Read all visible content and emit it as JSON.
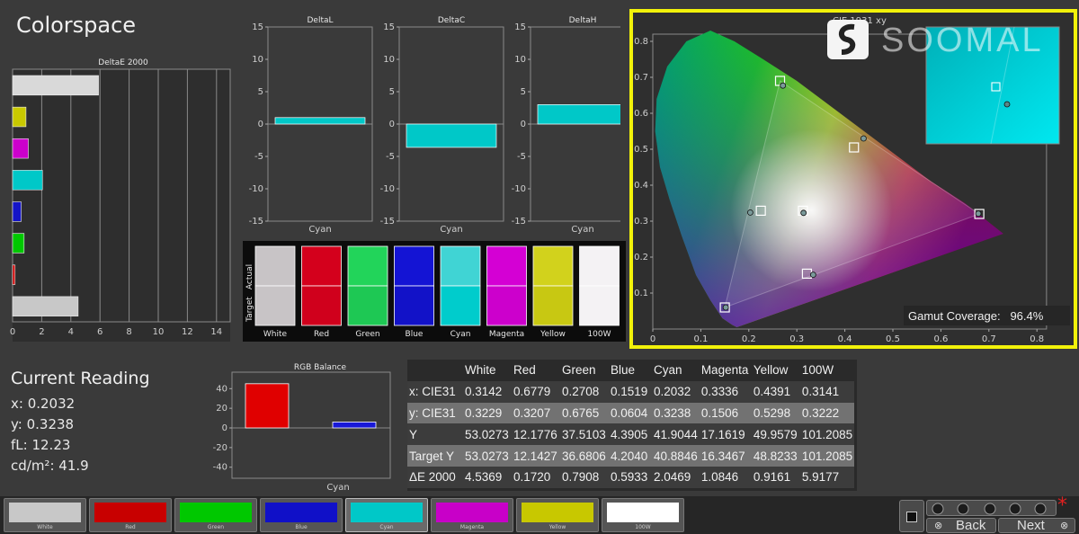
{
  "title": "Colorspace",
  "deltae": {
    "label": "DeltaE 2000",
    "xticks": [
      "0",
      "2",
      "4",
      "6",
      "8",
      "10",
      "12",
      "14"
    ],
    "bars": [
      {
        "name": "White",
        "value": 5.9,
        "color": "#d9d9d9"
      },
      {
        "name": "Yellow",
        "value": 0.92,
        "color": "#c9c900"
      },
      {
        "name": "Magenta",
        "value": 1.08,
        "color": "#cc00cc"
      },
      {
        "name": "Cyan",
        "value": 2.05,
        "color": "#00c8c8"
      },
      {
        "name": "Blue",
        "value": 0.59,
        "color": "#1414c8"
      },
      {
        "name": "Green",
        "value": 0.79,
        "color": "#00c800"
      },
      {
        "name": "Red",
        "value": 0.17,
        "color": "#c80000"
      },
      {
        "name": "100W",
        "value": 4.5,
        "color": "#c8c8c8"
      }
    ]
  },
  "delta_panels": [
    {
      "label": "DeltaL",
      "value": 1.0,
      "cat": "Cyan"
    },
    {
      "label": "DeltaC",
      "value": -3.6,
      "cat": "Cyan"
    },
    {
      "label": "DeltaH",
      "value": 3.0,
      "cat": "Cyan"
    }
  ],
  "delta_ticks": [
    "15",
    "10",
    "5",
    "0",
    "-5",
    "-10",
    "-15"
  ],
  "swatches": {
    "actual_label": "Actual",
    "target_label": "Target",
    "items": [
      {
        "label": "White",
        "actual": "#c8c4c6",
        "target": "#c8c4c6"
      },
      {
        "label": "Red",
        "actual": "#d4001c",
        "target": "#d0001c"
      },
      {
        "label": "Green",
        "actual": "#22d45a",
        "target": "#1ec854"
      },
      {
        "label": "Blue",
        "actual": "#1414d4",
        "target": "#1212c8"
      },
      {
        "label": "Cyan",
        "actual": "#40d4d4",
        "target": "#00cccc"
      },
      {
        "label": "Magenta",
        "actual": "#d400d4",
        "target": "#cc00cc"
      },
      {
        "label": "Yellow",
        "actual": "#d2d21c",
        "target": "#c8c812"
      },
      {
        "label": "100W",
        "actual": "#f4f2f4",
        "target": "#f4f2f4"
      }
    ]
  },
  "cie": {
    "label": "CIE 1931 xy",
    "xticks": [
      "0",
      "0.1",
      "0.2",
      "0.3",
      "0.4",
      "0.5",
      "0.6",
      "0.7",
      "0.8"
    ],
    "yticks": [
      "0.1",
      "0.2",
      "0.3",
      "0.4",
      "0.5",
      "0.6",
      "0.7",
      "0.8"
    ],
    "gamut_label": "Gamut Coverage:",
    "gamut_value": "96.4%",
    "targets": [
      [
        0.68,
        0.32
      ],
      [
        0.265,
        0.69
      ],
      [
        0.15,
        0.06
      ],
      [
        0.225,
        0.329
      ],
      [
        0.321,
        0.154
      ],
      [
        0.419,
        0.505
      ],
      [
        0.3127,
        0.329
      ]
    ],
    "measured": [
      [
        0.678,
        0.321
      ],
      [
        0.271,
        0.677
      ],
      [
        0.152,
        0.06
      ],
      [
        0.203,
        0.324
      ],
      [
        0.334,
        0.151
      ],
      [
        0.439,
        0.53
      ],
      [
        0.314,
        0.323
      ]
    ],
    "watermark": "SOOMAL"
  },
  "reading": {
    "title": "Current Reading",
    "lines": [
      "x: 0.2032",
      "y: 0.3238",
      "fL: 12.23",
      "cd/m²: 41.9"
    ]
  },
  "rgb_balance": {
    "label": "RGB Balance",
    "cat": "Cyan",
    "yticks": [
      "40",
      "20",
      "0",
      "-20",
      "-40"
    ],
    "red": 45,
    "blue": 6
  },
  "table": {
    "headers": [
      "",
      "White",
      "Red",
      "Green",
      "Blue",
      "Cyan",
      "Magenta",
      "Yellow",
      "100W"
    ],
    "rows": [
      [
        "x: CIE31",
        "0.3142",
        "0.6779",
        "0.2708",
        "0.1519",
        "0.2032",
        "0.3336",
        "0.4391",
        "0.3141"
      ],
      [
        "y: CIE31",
        "0.3229",
        "0.3207",
        "0.6765",
        "0.0604",
        "0.3238",
        "0.1506",
        "0.5298",
        "0.3222"
      ],
      [
        "Y",
        "53.0273",
        "12.1776",
        "37.5103",
        "4.3905",
        "41.9044",
        "17.1619",
        "49.9579",
        "101.2085"
      ],
      [
        "Target Y",
        "53.0273",
        "12.1427",
        "36.6806",
        "4.2040",
        "40.8846",
        "16.3467",
        "48.8233",
        "101.2085"
      ],
      [
        "ΔE 2000",
        "4.5369",
        "0.1720",
        "0.7908",
        "0.5933",
        "2.0469",
        "1.0846",
        "0.9161",
        "5.9177"
      ]
    ]
  },
  "patches": [
    {
      "label": "White",
      "color": "#c8c8c8"
    },
    {
      "label": "Red",
      "color": "#c80000"
    },
    {
      "label": "Green",
      "color": "#00c800"
    },
    {
      "label": "Blue",
      "color": "#1010c8"
    },
    {
      "label": "Cyan",
      "color": "#00c8c8",
      "selected": true
    },
    {
      "label": "Magenta",
      "color": "#c800c8"
    },
    {
      "label": "Yellow",
      "color": "#c8c800"
    },
    {
      "label": "100W",
      "color": "#ffffff"
    }
  ],
  "nav": {
    "back": "Back",
    "next": "Next"
  }
}
